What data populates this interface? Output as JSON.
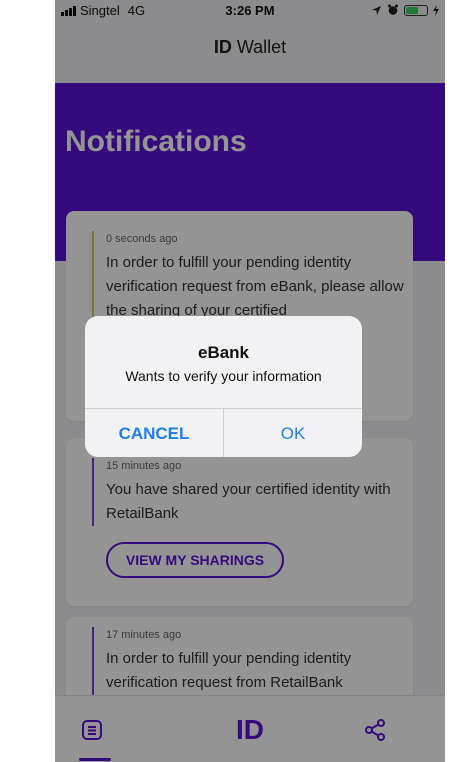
{
  "status_bar": {
    "carrier": "Singtel",
    "network": "4G",
    "time": "3:26 PM"
  },
  "nav": {
    "title_bold": "ID",
    "title_rest": "Wallet"
  },
  "header": {
    "title": "Notifications"
  },
  "notifications": [
    {
      "time": "0 seconds ago",
      "message": "In order to fulfill your pending identity verification request from eBank, please allow the sharing of your certified"
    },
    {
      "time": "15 minutes ago",
      "message": "You have shared your certified identity with RetailBank",
      "button": "VIEW MY SHARINGS"
    },
    {
      "time": "17 minutes ago",
      "message": "In order to fulfill your pending identity verification request from RetailBank"
    }
  ],
  "tabbar": {
    "id_label": "ID"
  },
  "dialog": {
    "title": "eBank",
    "message": "Wants to verify your information",
    "cancel": "CANCEL",
    "ok": "OK"
  },
  "colors": {
    "brand": "#5b12d8",
    "ios_blue": "#1f7fe8"
  },
  "icons": [
    "location-arrow-icon",
    "alarm-icon",
    "battery-icon",
    "list-icon",
    "share-icon"
  ]
}
